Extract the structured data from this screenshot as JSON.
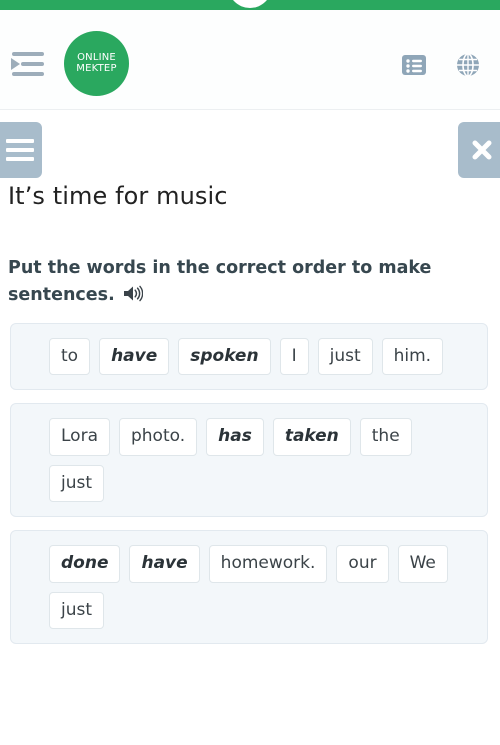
{
  "header": {
    "menu_toggle_icon": "sidebar-expand-icon",
    "logo": {
      "line1": "ONLINE",
      "line2": "MEKTEP",
      "color": "#2aa85f"
    },
    "list_icon": "list-icon",
    "globe_icon": "globe-icon",
    "strip_color": "#2aa85f"
  },
  "actions": {
    "menu_button_icon": "hamburger-icon",
    "close_button_icon": "close-icon",
    "button_color": "#a8bccb"
  },
  "title": "It’s time for music",
  "instruction": {
    "text": "Put the words in the correct order to make sentences.",
    "audio_icon": "speaker-icon"
  },
  "questions": [
    {
      "id": 1,
      "words": [
        {
          "text": "to",
          "emphasis": false
        },
        {
          "text": "have",
          "emphasis": true
        },
        {
          "text": "spoken",
          "emphasis": true
        },
        {
          "text": "I",
          "emphasis": false
        },
        {
          "text": "just",
          "emphasis": false
        },
        {
          "text": "him.",
          "emphasis": false
        }
      ]
    },
    {
      "id": 2,
      "words": [
        {
          "text": "Lora",
          "emphasis": false
        },
        {
          "text": "photo.",
          "emphasis": false
        },
        {
          "text": "has",
          "emphasis": true
        },
        {
          "text": "taken",
          "emphasis": true
        },
        {
          "text": "the",
          "emphasis": false
        },
        {
          "text": "just",
          "emphasis": false
        }
      ]
    },
    {
      "id": 3,
      "words": [
        {
          "text": "done",
          "emphasis": true
        },
        {
          "text": "have",
          "emphasis": true
        },
        {
          "text": "homework.",
          "emphasis": false
        },
        {
          "text": "our",
          "emphasis": false
        },
        {
          "text": "We",
          "emphasis": false
        },
        {
          "text": "just",
          "emphasis": false
        }
      ]
    }
  ]
}
